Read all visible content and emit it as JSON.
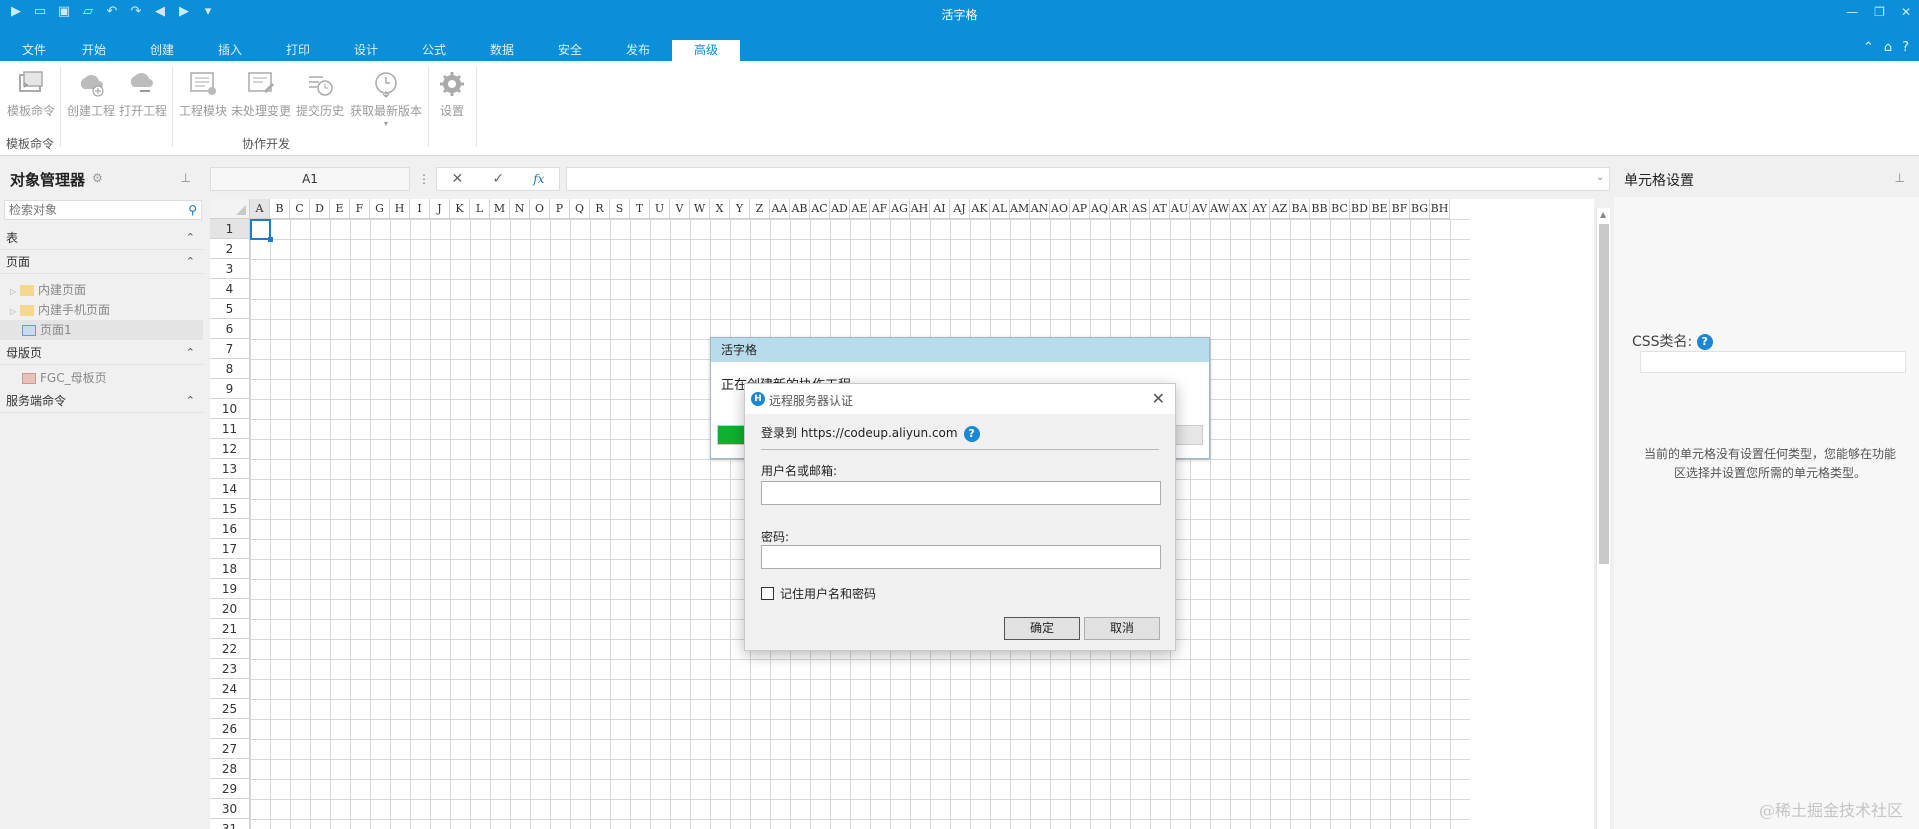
{
  "window": {
    "title": "活字格"
  },
  "tabs": [
    "文件",
    "开始",
    "创建",
    "插入",
    "打印",
    "设计",
    "公式",
    "数据",
    "安全",
    "发布",
    "高级"
  ],
  "active_tab": "高级",
  "ribbon": {
    "buttons": [
      "模板命令",
      "创建工程",
      "打开工程",
      "工程模块",
      "未处理变更",
      "提交历史",
      "获取最新版本",
      "设置"
    ],
    "groups": [
      "模板命令",
      "协作开发"
    ]
  },
  "left_panel": {
    "title": "对象管理器",
    "search_placeholder": "检索对象",
    "sections": {
      "table": "表",
      "page": "页面",
      "master": "母版页",
      "server": "服务端命令"
    },
    "page_items": [
      "内建页面",
      "内建手机页面",
      "页面1"
    ],
    "master_items": [
      "FGC_母板页"
    ]
  },
  "formula_bar": {
    "cell_ref": "A1",
    "fx": "fx"
  },
  "grid": {
    "columns": [
      "A",
      "B",
      "C",
      "D",
      "E",
      "F",
      "G",
      "H",
      "I",
      "J",
      "K",
      "L",
      "M",
      "N",
      "O",
      "P",
      "Q",
      "R",
      "S",
      "T",
      "U",
      "V",
      "W",
      "X",
      "Y",
      "Z",
      "AA",
      "AB",
      "AC",
      "AD",
      "AE",
      "AF",
      "AG",
      "AH",
      "AI",
      "AJ",
      "AK",
      "AL",
      "AM",
      "AN",
      "AO",
      "AP",
      "AQ",
      "AR",
      "AS",
      "AT",
      "AU",
      "AV",
      "AW",
      "AX",
      "AY",
      "AZ",
      "BA",
      "BB",
      "BC",
      "BD",
      "BE",
      "BF",
      "BG",
      "BH"
    ],
    "rows": [
      "1",
      "2",
      "3",
      "4",
      "5",
      "6",
      "7",
      "8",
      "9",
      "10",
      "11",
      "12",
      "13",
      "14",
      "15",
      "16",
      "17",
      "18",
      "19",
      "20",
      "21",
      "22",
      "23",
      "24",
      "25",
      "26",
      "27",
      "28",
      "29",
      "30",
      "31"
    ]
  },
  "right_panel": {
    "title": "单元格设置",
    "css_label": "CSS类名:",
    "description": "当前的单元格没有设置任何类型，您能够在功能区选择并设置您所需的单元格类型。"
  },
  "progress_dialog": {
    "title": "活字格",
    "message": "正在创建新的协作工程...",
    "progress": 0.12
  },
  "login_dialog": {
    "icon_letter": "H",
    "title": "远程服务器认证",
    "site_text": "登录到 https://codeup.aliyun.com",
    "username_label": "用户名或邮箱:",
    "username_value": "",
    "password_label": "密码:",
    "password_value": "",
    "remember_label": "记住用户名和密码",
    "ok_label": "确定",
    "cancel_label": "取消"
  },
  "watermark": "@稀土掘金技术社区",
  "colors": {
    "accent": "#0a8fd8",
    "progress": "#11b02f",
    "active_cell": "#1f7ac8"
  }
}
